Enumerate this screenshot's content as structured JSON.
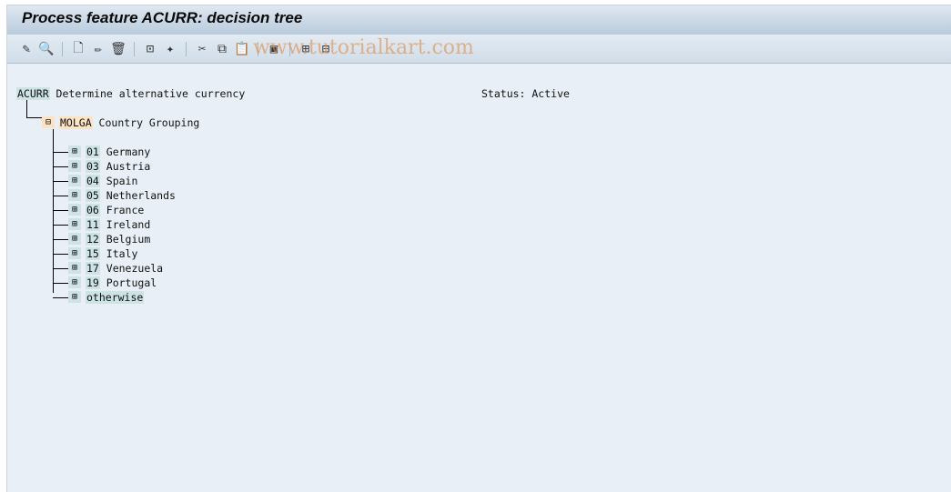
{
  "title": "Process feature ACURR: decision tree",
  "watermark": "www.tutorialkart.com",
  "toolbar": [
    {
      "name": "change-icon",
      "glyph": "✎"
    },
    {
      "name": "display-icon",
      "glyph": "🔍"
    },
    {
      "sep": true
    },
    {
      "name": "create-icon",
      "glyph": "🗋"
    },
    {
      "name": "edit-icon",
      "glyph": "✏"
    },
    {
      "name": "delete-icon",
      "glyph": "🗑"
    },
    {
      "sep": true
    },
    {
      "name": "structure-icon",
      "glyph": "⊡"
    },
    {
      "name": "highlight-icon",
      "glyph": "✦"
    },
    {
      "sep": true
    },
    {
      "name": "cut-icon",
      "glyph": "✂"
    },
    {
      "name": "copy-icon",
      "glyph": "⧉"
    },
    {
      "name": "paste-icon",
      "glyph": "📋"
    },
    {
      "sep": true
    },
    {
      "name": "select-icon",
      "glyph": "▣"
    },
    {
      "sep": true
    },
    {
      "name": "expand-icon",
      "glyph": "⊞"
    },
    {
      "name": "collapse-icon",
      "glyph": "⊟"
    }
  ],
  "root": {
    "key": "ACURR",
    "text": " Determine alternative currency",
    "status": "Status: Active"
  },
  "group": {
    "key": "MOLGA",
    "text": " Country Grouping"
  },
  "nodes": [
    {
      "key": "01",
      "text": " Germany"
    },
    {
      "key": "03",
      "text": " Austria"
    },
    {
      "key": "04",
      "text": " Spain"
    },
    {
      "key": "05",
      "text": " Netherlands"
    },
    {
      "key": "06",
      "text": " France"
    },
    {
      "key": "11",
      "text": " Ireland"
    },
    {
      "key": "12",
      "text": " Belgium"
    },
    {
      "key": "15",
      "text": " Italy"
    },
    {
      "key": "17",
      "text": " Venezuela"
    },
    {
      "key": "19",
      "text": " Portugal"
    },
    {
      "key": "otherwise",
      "text": ""
    }
  ]
}
